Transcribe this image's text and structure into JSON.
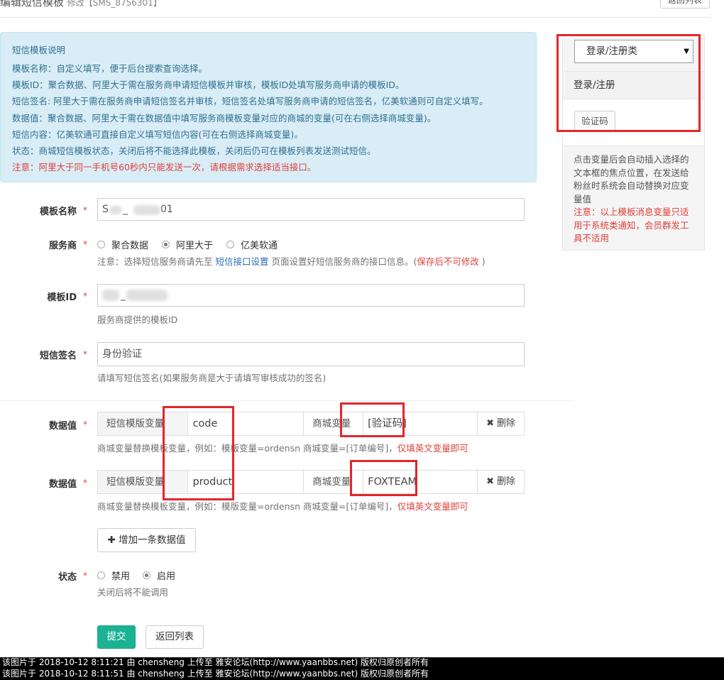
{
  "header": {
    "title": "编辑短信模板",
    "subtitle": "修改【SMS_8756301】",
    "back_label": "返回列表"
  },
  "info": {
    "heading": "短信模板说明",
    "lines": [
      "模板名称：自定义填写，便于后台搜索查询选择。",
      "模板ID：聚合数据、阿里大于需在服务商申请短信模板并审核，模板ID处填写服务商申请的模板ID。",
      "短信签名: 阿里大于需在服务商申请短信签名并审核，短信签名处填写服务商申请的短信签名，亿美软通则可自定义填写。",
      "数据值：聚合数据、阿里大于需在数据值中填写服务商模板变量对应的商城的变量(可在右侧选择商城变量)。",
      "短信内容：亿美软通可直接自定义填写短信内容(可在右侧选择商城变量)。",
      "状态：商城短信模板状态，关闭后将不能选择此模板，关闭后仍可在模板列表发送测试短信。"
    ],
    "warning": "注意：阿里大于同一手机号60秒内只能发送一次，请根据需求选择适当接口。"
  },
  "form": {
    "name": {
      "label": "模板名称",
      "value_start": "S",
      "value_mid": "_",
      "value_end": "01"
    },
    "provider": {
      "label": "服务商",
      "options": [
        "聚合数据",
        "阿里大于",
        "亿美软通"
      ],
      "selected": "阿里大于",
      "help_pre": "注意：选择短信服务商请先至",
      "help_link": "短信接口设置",
      "help_mid": "页面设置好短信服务商的接口信息。(",
      "help_red": "保存后不可修改",
      "help_post": ")"
    },
    "template_id": {
      "label": "模板ID",
      "value_mid": "_",
      "help": "服务商提供的模板ID"
    },
    "signature": {
      "label": "短信签名",
      "value": "身份验证",
      "help": "请填写短信签名(如果服务商是大于请填写审核成功的签名)"
    },
    "data_values": [
      {
        "label": "数据值",
        "tpl_addon": "短信模版变量",
        "tpl_value": "code",
        "mall_addon": "商城变量",
        "mall_value": "[验证码]",
        "delete": "删除",
        "help": "商城变量替换模板变量，例如：模版变量=ordensn 商城变量=[订单编号]，",
        "help_red": "仅填英文变量即可"
      },
      {
        "label": "数据值",
        "tpl_addon": "短信模版变量",
        "tpl_value": "product",
        "mall_addon": "商城变量",
        "mall_value": "FOXTEAM",
        "delete": "删除",
        "help": "商城变量替换模板变量，例如：模版变量=ordensn 商城变量=[订单编号]，",
        "help_red": "仅填英文变量即可"
      }
    ],
    "add_label": "增加一条数据值",
    "status": {
      "label": "状态",
      "options": [
        "禁用",
        "启用"
      ],
      "selected": "启用",
      "help": "关闭后将不能调用"
    },
    "required_mark": "*",
    "submit": "提交",
    "back": "返回列表"
  },
  "sidebar": {
    "select_value": "登录/注册类",
    "group_title": "登录/注册",
    "variable_button": "验证码",
    "note": "点击变量后会自动插入选择的文本框的焦点位置，在发送给粉丝时系统会自动替换对应变量值",
    "note_red": "注意：以上模板消息变量只适用于系统类通知，会员群发工具不适用"
  },
  "watermark": [
    "该图片于 2018-10-12 8:11:21 由 chensheng 上传至 雅安论坛(http://www.yaanbbs.net) 版权归原创者所有",
    "该图片于 2018-10-12 8:11:51 由 chensheng 上传至 雅安论坛(http://www.yaanbbs.net) 版权归原创者所有"
  ],
  "colors": {
    "accent": "#1cb394",
    "info_bg": "#d9edf7",
    "warning": "#e0403a",
    "highlight_box": "#e0272b"
  }
}
